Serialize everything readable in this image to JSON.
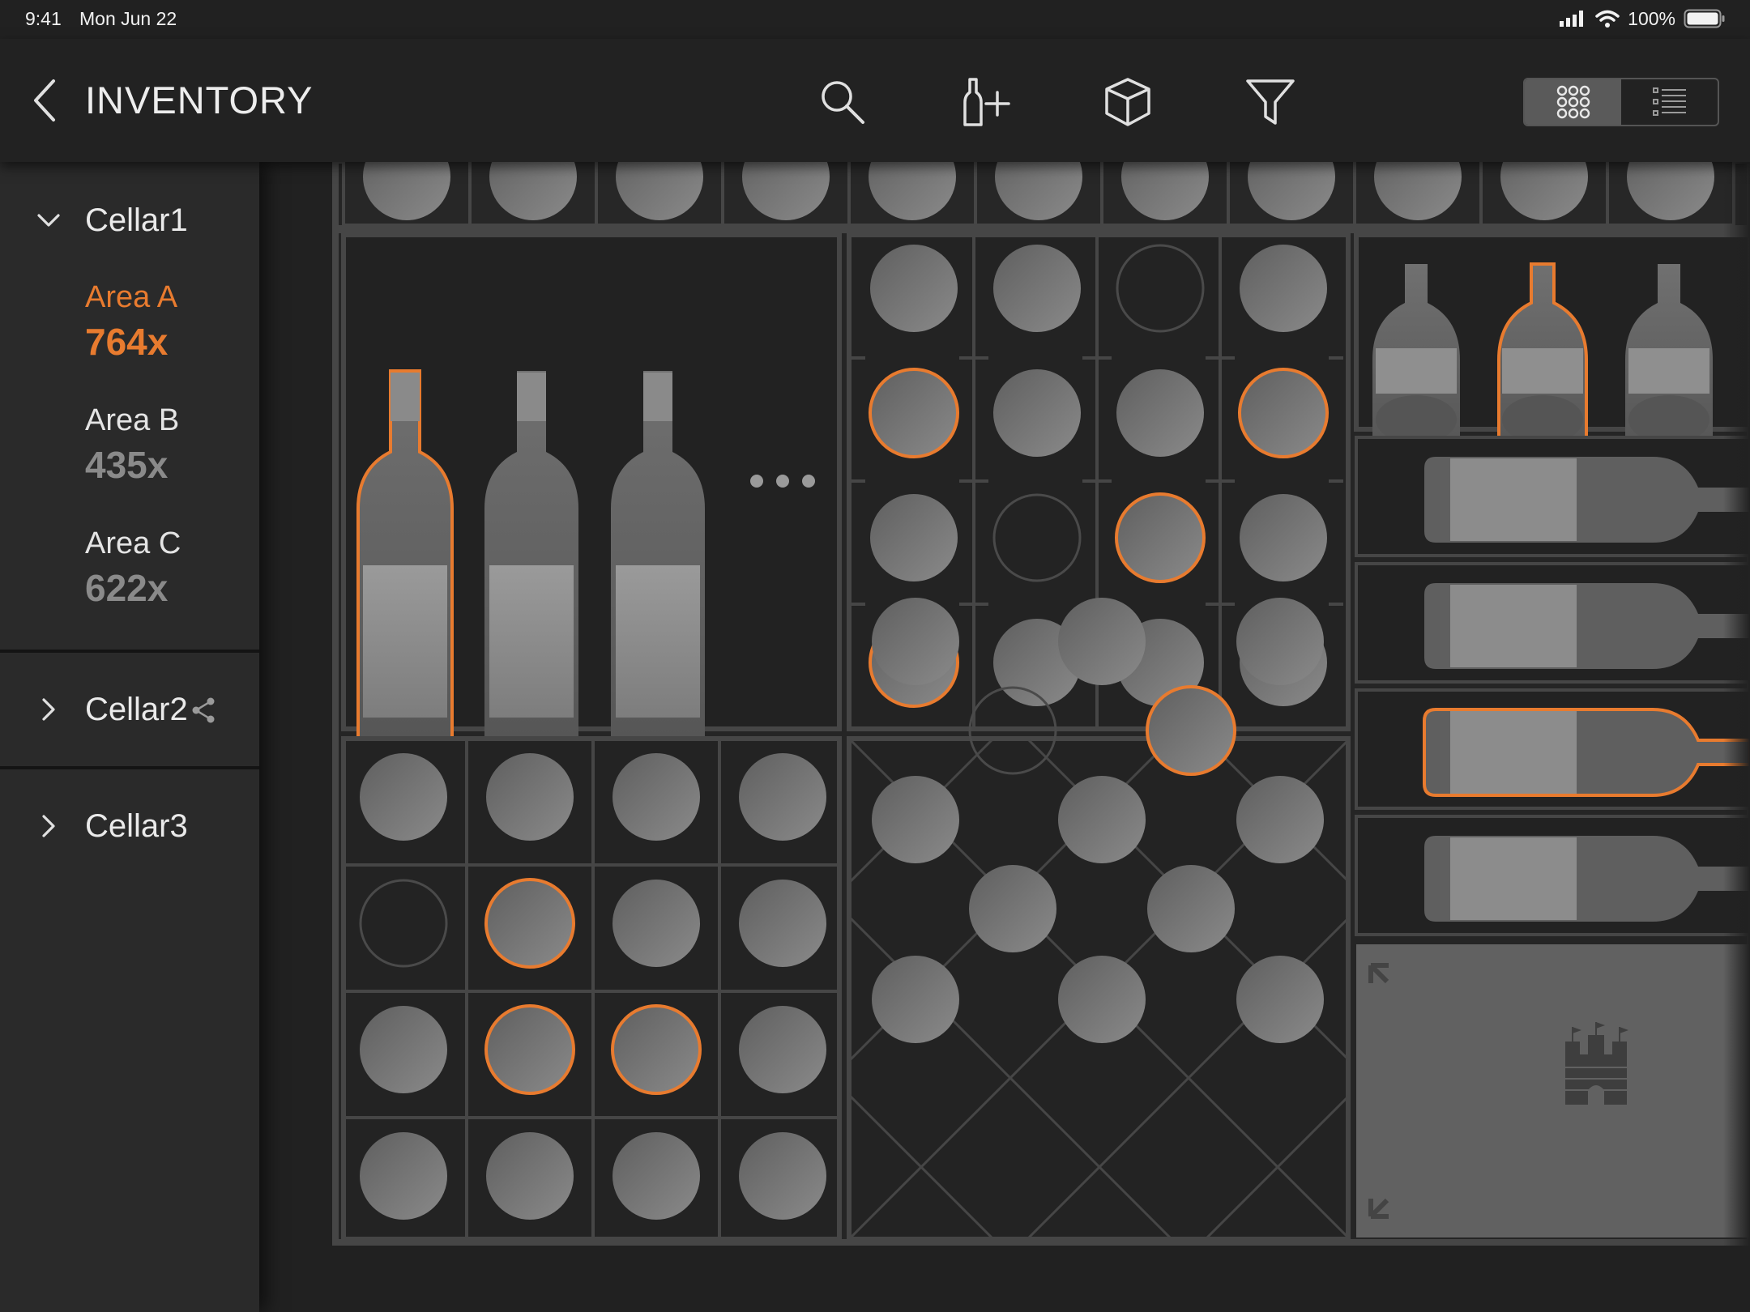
{
  "status_bar": {
    "time": "9:41",
    "date": "Mon Jun 22",
    "battery": "100%"
  },
  "nav": {
    "title": "INVENTORY",
    "tools": [
      "search-icon",
      "add-bottle-icon",
      "box-3d-icon",
      "filter-icon"
    ],
    "view_options": [
      "grid-view-icon",
      "list-view-icon"
    ],
    "active_view": "grid"
  },
  "sidebar": {
    "cellars": [
      {
        "name": "Cellar1",
        "expanded": true,
        "areas": [
          {
            "name": "Area A",
            "count": "764x",
            "selected": true
          },
          {
            "name": "Area B",
            "count": "435x",
            "selected": false
          },
          {
            "name": "Area C",
            "count": "622x",
            "selected": false
          }
        ]
      },
      {
        "name": "Cellar2",
        "expanded": false,
        "shared": true
      },
      {
        "name": "Cellar3",
        "expanded": false,
        "shared": false
      }
    ]
  },
  "colors": {
    "accent": "#e87b2f",
    "background": "#212121",
    "sidebar": "#2a2a2a",
    "rack_line": "#464646",
    "bottle": "#7a7a7a"
  },
  "rack": {
    "top_strip": {
      "slots": 11,
      "selected": []
    },
    "standing_bottles": {
      "count": 3,
      "selected": [
        0
      ],
      "more_indicator": true
    },
    "grid_4x4_top": {
      "rows": 4,
      "cols": 4,
      "empty": [
        [
          0,
          2
        ],
        [
          2,
          1
        ]
      ],
      "selected": [
        [
          1,
          0
        ],
        [
          1,
          3
        ],
        [
          2,
          2
        ],
        [
          3,
          0
        ]
      ]
    },
    "upright_bottles": {
      "count": 3,
      "selected": [
        1
      ]
    },
    "lying_bottles": {
      "count": 4,
      "selected": [
        2
      ]
    },
    "grid_4x4_bottom": {
      "rows": 4,
      "cols": 4,
      "empty": [
        [
          1,
          0
        ]
      ],
      "selected": [
        [
          1,
          1
        ],
        [
          2,
          1
        ],
        [
          2,
          2
        ]
      ]
    },
    "diamond_bin": {
      "bottles": 13,
      "empty": 1,
      "selected": 1
    },
    "storage_box": {
      "icon": "castle-icon"
    }
  }
}
